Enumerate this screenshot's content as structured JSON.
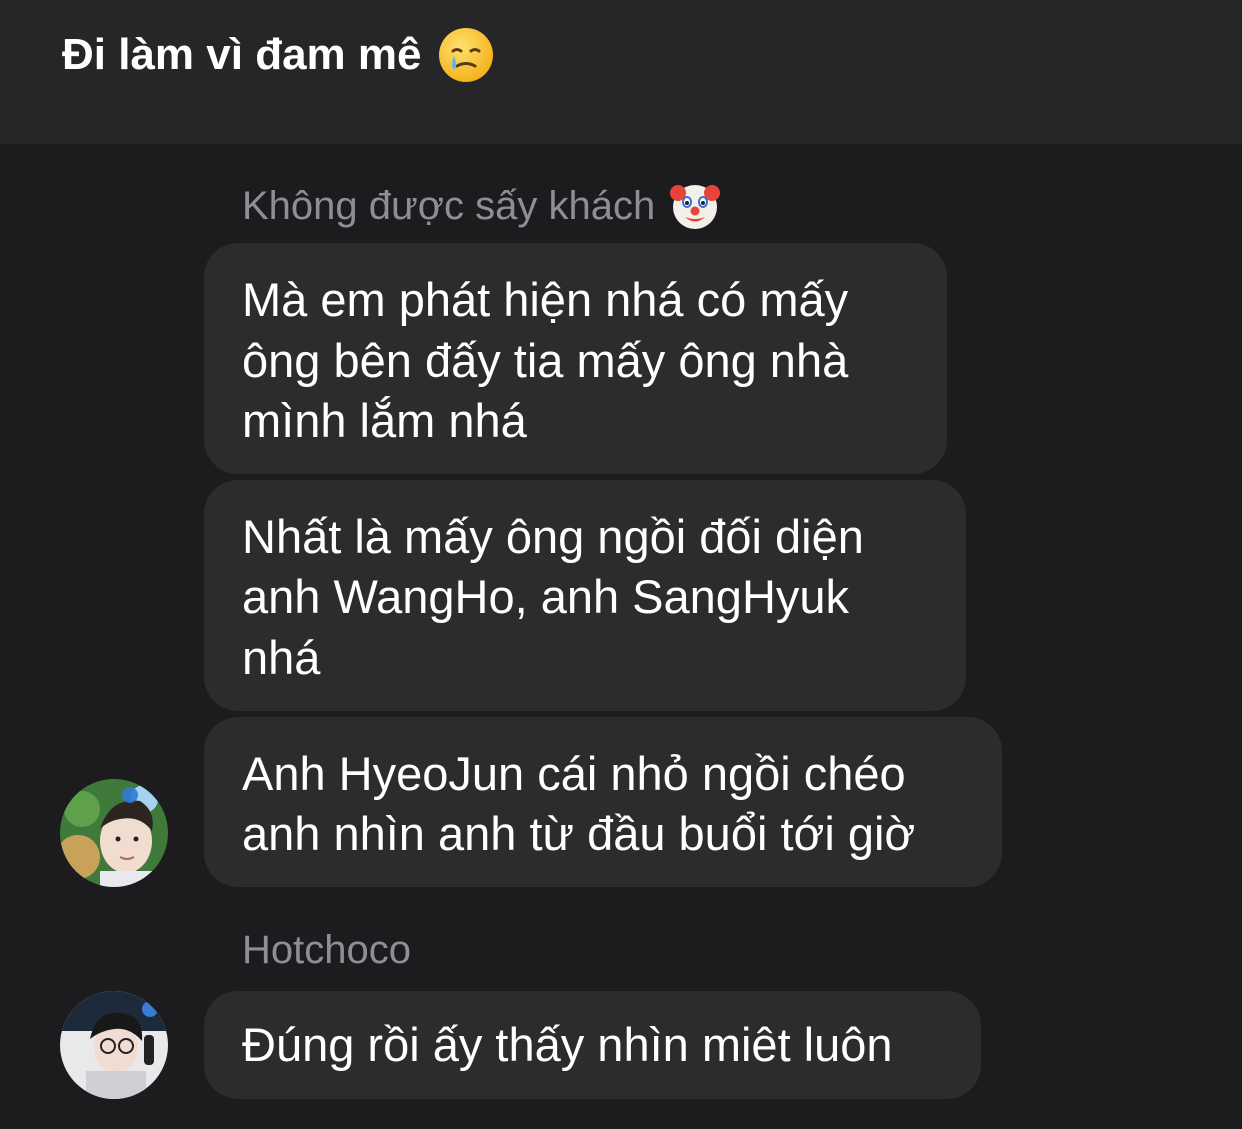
{
  "header": {
    "title": "Đi làm vì đam mê",
    "title_emoji": "crying-face-emoji"
  },
  "groups": [
    {
      "sender": "Không được sấy khách",
      "sender_emoji": "clown-face-emoji",
      "messages": [
        {
          "lines": [
            "Mà em phát hiện nhá có mấy",
            "ông bên đấy tia mấy ông nhà",
            "mình lắm nhá"
          ]
        },
        {
          "lines": [
            "Nhất là mấy ông ngồi đối diện",
            "anh WangHo, anh SangHyuk",
            "nhá"
          ]
        },
        {
          "lines": [
            "Anh HyeoJun cái nhỏ ngồi chéo",
            "anh nhìn anh từ đầu buổi tới giờ"
          ]
        }
      ]
    },
    {
      "sender": "Hotchoco",
      "messages": [
        {
          "lines": [
            "Đúng rồi ấy thấy nhìn miêt luôn"
          ]
        }
      ]
    }
  ],
  "colors": {
    "background": "#1c1c1e",
    "header": "#262628",
    "bubble": "#2c2c2e",
    "sender_label": "#8e8e93",
    "text": "#ffffff"
  }
}
